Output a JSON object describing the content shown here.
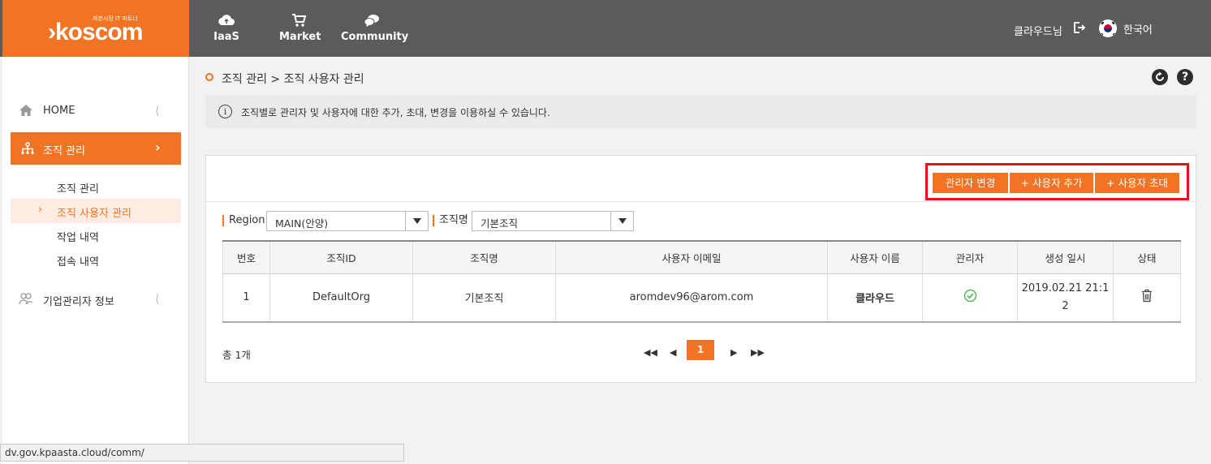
{
  "header": {
    "logo_tagline": "자본시장 IT 파트너",
    "logo_text": "koscom",
    "nav": [
      {
        "label": "IaaS",
        "icon": "cloud-icon"
      },
      {
        "label": "Market",
        "icon": "cart-icon"
      },
      {
        "label": "Community",
        "icon": "chat-icon"
      }
    ],
    "user_name": "클라우드님",
    "language": "한국어"
  },
  "sidebar": {
    "home": "HOME",
    "org_mgmt": "조직 관리",
    "sub_items": [
      "조직 관리",
      "조직 사용자 관리",
      "작업 내역",
      "접속 내역"
    ],
    "active_sub_index": 1,
    "corp_admin": "기업관리자 정보"
  },
  "breadcrumb": "조직 관리 > 조직 사용자 관리",
  "info_message": "조직별로 관리자 및 사용자에 대한 추가, 초대, 변경을 이용하실 수 있습니다.",
  "toolbar": {
    "change_admin": "관리자 변경",
    "add_user": "+ 사용자 추가",
    "invite_user": "+ 사용자 초대"
  },
  "filters": {
    "region_label": "Region",
    "region_value": "MAIN(안양)",
    "org_label": "조직명",
    "org_value": "기본조직"
  },
  "table": {
    "headers": [
      "번호",
      "조직ID",
      "조직명",
      "사용자 이메일",
      "사용자 이름",
      "관리자",
      "생성 일시",
      "상태"
    ],
    "rows": [
      {
        "no": "1",
        "org_id": "DefaultOrg",
        "org_name": "기본조직",
        "email": "aromdev96@arom.com",
        "user_name": "클라우드",
        "is_admin": true,
        "created_line1": "2019.02.21 21:1",
        "created_line2": "2"
      }
    ]
  },
  "total": "총 1개",
  "pagination": {
    "current": "1"
  },
  "status_url": "dv.gov.kpaasta.cloud/comm/",
  "colors": {
    "brand": "#f07423",
    "topbar": "#5b5b5b",
    "highlight": "#e4111b",
    "check": "#5cb85c"
  }
}
